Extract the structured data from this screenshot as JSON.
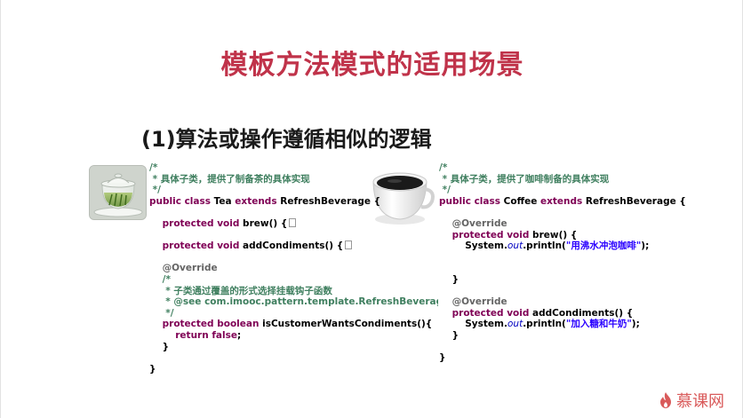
{
  "slide": {
    "title": "模板方法模式的适用场景",
    "subtitle": "(1)算法或操作遵循相似的逻辑"
  },
  "images": {
    "tea": "tea-glass-cup-image",
    "coffee": "coffee-cup-image"
  },
  "code_left": [
    [
      {
        "c": "cm",
        "t": "/*"
      }
    ],
    [
      {
        "c": "cm",
        "t": " * 具体子类，提供了制备茶的具体实现"
      }
    ],
    [
      {
        "c": "cm",
        "t": " */"
      }
    ],
    [
      {
        "c": "kw",
        "t": "public class "
      },
      {
        "c": "tx",
        "t": "Tea "
      },
      {
        "c": "kw",
        "t": "extends "
      },
      {
        "c": "tx",
        "t": "RefreshBeverage {"
      }
    ],
    [],
    [
      {
        "c": "tx",
        "t": "    "
      },
      {
        "c": "kw",
        "t": "protected void "
      },
      {
        "c": "tx",
        "t": "brew() {"
      },
      {
        "c": "fold",
        "t": ""
      }
    ],
    [],
    [
      {
        "c": "tx",
        "t": "    "
      },
      {
        "c": "kw",
        "t": "protected void "
      },
      {
        "c": "tx",
        "t": "addCondiments() {"
      },
      {
        "c": "fold",
        "t": ""
      }
    ],
    [],
    [
      {
        "c": "an",
        "t": "    @Override"
      }
    ],
    [
      {
        "c": "cm",
        "t": "    /*"
      }
    ],
    [
      {
        "c": "cm",
        "t": "     * 子类通过覆盖的形式选择挂载钩子函数"
      }
    ],
    [
      {
        "c": "cm",
        "t": "     * @see com.imooc.pattern.template.RefreshBeverage#isCustomerWantsCondiments()"
      }
    ],
    [
      {
        "c": "cm",
        "t": "     */"
      }
    ],
    [
      {
        "c": "tx",
        "t": "    "
      },
      {
        "c": "kw",
        "t": "protected boolean "
      },
      {
        "c": "tx",
        "t": "isCustomerWantsCondiments(){"
      }
    ],
    [
      {
        "c": "tx",
        "t": "        "
      },
      {
        "c": "kw",
        "t": "return false"
      },
      {
        "c": "tx",
        "t": ";"
      }
    ],
    [
      {
        "c": "tx",
        "t": "    }"
      }
    ],
    [],
    [
      {
        "c": "tx",
        "t": "}"
      }
    ]
  ],
  "code_right": [
    [
      {
        "c": "cm",
        "t": "/*"
      }
    ],
    [
      {
        "c": "cm",
        "t": " * 具体子类，提供了咖啡制备的具体实现"
      }
    ],
    [
      {
        "c": "cm",
        "t": " */"
      }
    ],
    [
      {
        "c": "kw",
        "t": "public class "
      },
      {
        "c": "tx",
        "t": "Coffee "
      },
      {
        "c": "kw",
        "t": "extends "
      },
      {
        "c": "tx",
        "t": "RefreshBeverage {"
      }
    ],
    [],
    [
      {
        "c": "an",
        "t": "    @Override"
      }
    ],
    [
      {
        "c": "tx",
        "t": "    "
      },
      {
        "c": "kw",
        "t": "protected void "
      },
      {
        "c": "tx",
        "t": "brew() {"
      }
    ],
    [
      {
        "c": "tx",
        "t": "        System."
      },
      {
        "c": "it",
        "t": "out"
      },
      {
        "c": "tx",
        "t": ".println("
      },
      {
        "c": "st",
        "t": "\"用沸水冲泡咖啡\""
      },
      {
        "c": "tx",
        "t": ");"
      }
    ],
    [],
    [],
    [
      {
        "c": "tx",
        "t": "    }"
      }
    ],
    [],
    [
      {
        "c": "an",
        "t": "    @Override"
      }
    ],
    [
      {
        "c": "tx",
        "t": "    "
      },
      {
        "c": "kw",
        "t": "protected void "
      },
      {
        "c": "tx",
        "t": "addCondiments() {"
      }
    ],
    [
      {
        "c": "tx",
        "t": "        System."
      },
      {
        "c": "it",
        "t": "out"
      },
      {
        "c": "tx",
        "t": ".println("
      },
      {
        "c": "st",
        "t": "\"加入糖和牛奶\""
      },
      {
        "c": "tx",
        "t": ");"
      }
    ],
    [
      {
        "c": "tx",
        "t": "    }"
      }
    ],
    [],
    [
      {
        "c": "tx",
        "t": "}"
      }
    ]
  ],
  "branding": {
    "logo_text": "慕课网",
    "logo_color": "#d95a5a",
    "icon": "flame-icon"
  },
  "colors": {
    "title": "#c0334a",
    "comment": "#3f7f5f",
    "keyword": "#7f0055",
    "annotation": "#646464",
    "string": "#2a00ff",
    "field": "#0000c0"
  }
}
